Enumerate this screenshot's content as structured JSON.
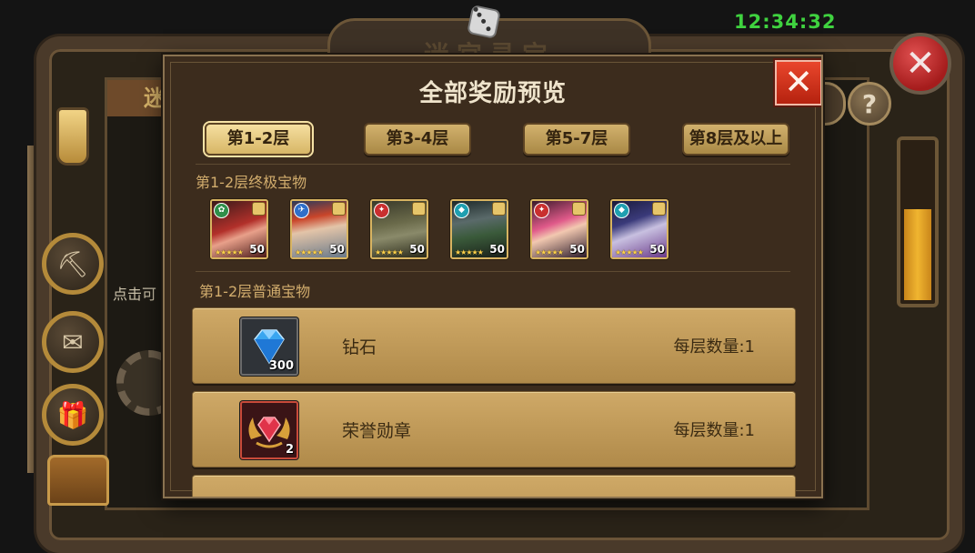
{
  "clock": "12:34:32",
  "background": {
    "title": "迷宫寻宝",
    "left_tab": "迷",
    "click_hint": "点击可"
  },
  "modal": {
    "title": "全部奖励预览",
    "close_icon": "close-x-icon",
    "tabs": [
      {
        "label": "第1-2层",
        "active": true
      },
      {
        "label": "第3-4层",
        "active": false
      },
      {
        "label": "第5-7层",
        "active": false
      },
      {
        "label": "第8层及以上",
        "active": false
      }
    ],
    "ultimate_section_label": "第1-2层终极宝物",
    "heroes": [
      {
        "level": "50",
        "stars": "★★★★★",
        "element": "green",
        "element_icon": "nature-element-icon"
      },
      {
        "level": "50",
        "stars": "★★★★★",
        "element": "blue",
        "element_icon": "wing-element-icon"
      },
      {
        "level": "50",
        "stars": "★★★★★",
        "element": "red",
        "element_icon": "fire-element-icon"
      },
      {
        "level": "50",
        "stars": "★★★★★",
        "element": "teal",
        "element_icon": "water-element-icon"
      },
      {
        "level": "50",
        "stars": "★★★★★",
        "element": "red",
        "element_icon": "fire-element-icon"
      },
      {
        "level": "50",
        "stars": "★★★★★",
        "element": "teal",
        "element_icon": "water-element-icon"
      }
    ],
    "normal_section_label": "第1-2层普通宝物",
    "items": [
      {
        "name": "钻石",
        "qty": "300",
        "count": "每层数量:1",
        "icon": "diamond-icon"
      },
      {
        "name": "荣誉勋章",
        "qty": "2",
        "count": "每层数量:1",
        "icon": "honor-medal-icon"
      }
    ]
  },
  "colors": {
    "clock": "#3fd23f",
    "modal_bg": "#3c2c1d",
    "tab_gold": "#d2b16d",
    "row_gold": "#cfa967",
    "close_red": "#d83a22"
  }
}
